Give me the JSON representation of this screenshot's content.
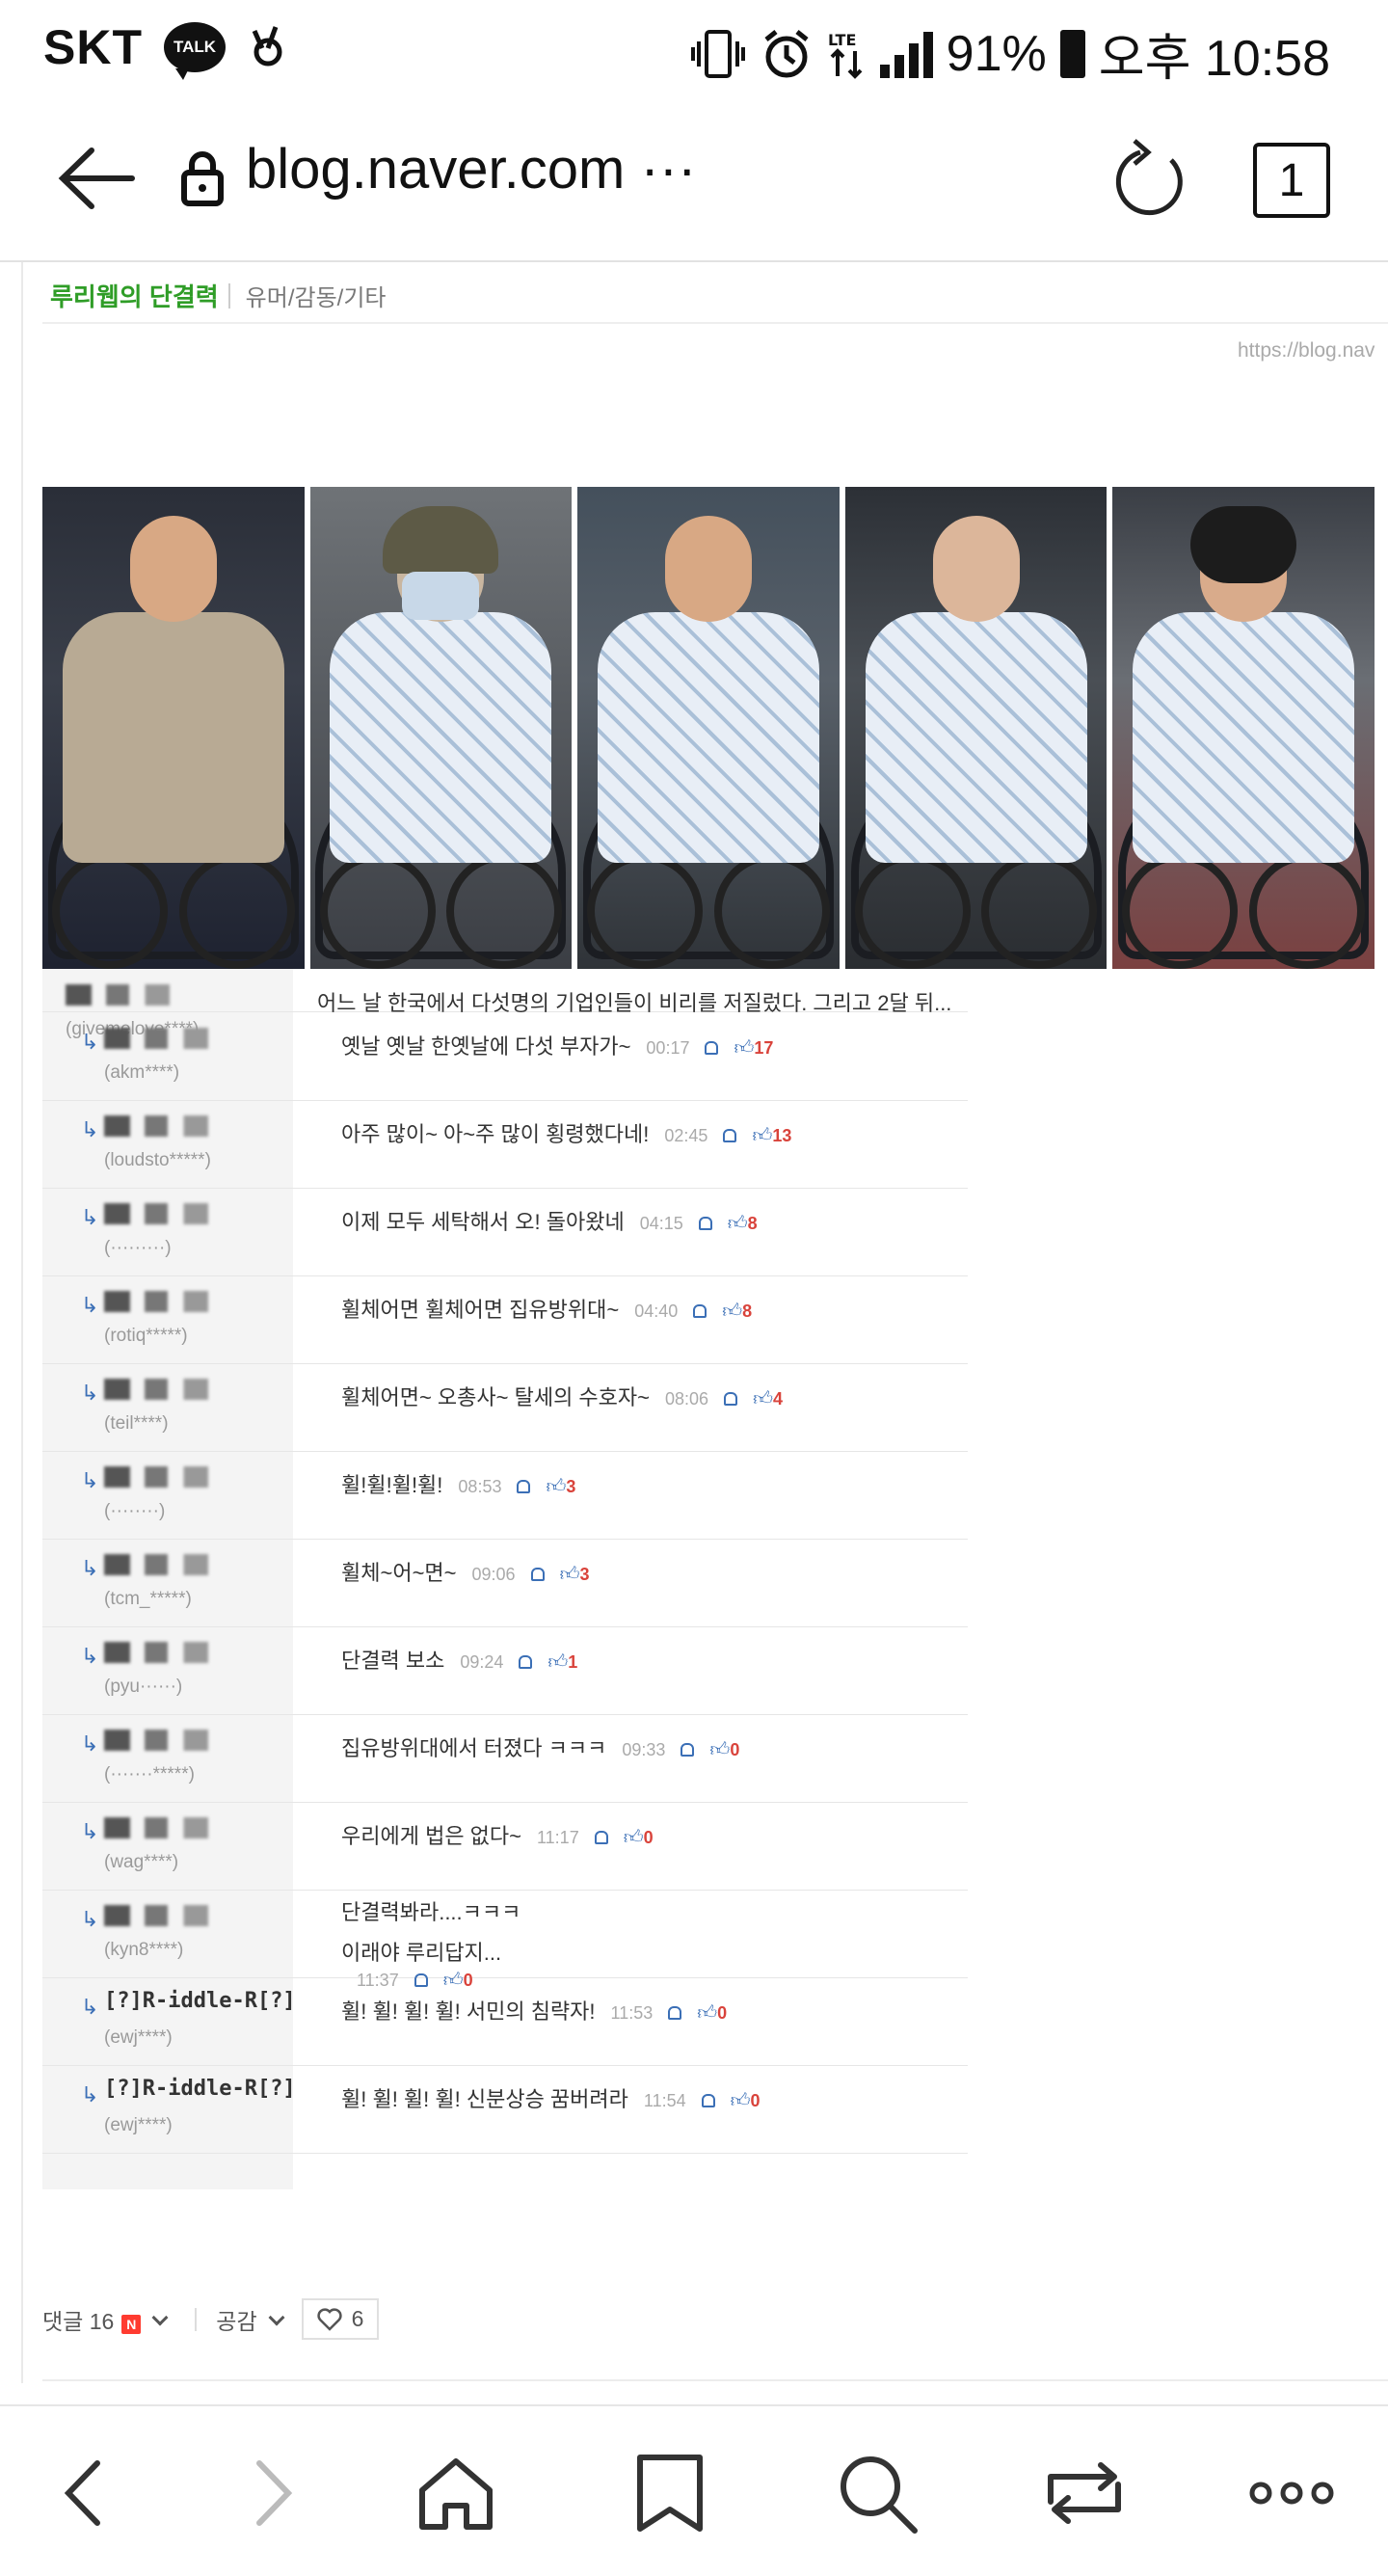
{
  "status_bar": {
    "carrier": "SKT",
    "talk_badge": "TALK",
    "battery_percent": "91%",
    "time": "오후 10:58",
    "battery_level": 0.91
  },
  "address_bar": {
    "url": "blog.naver.com ···",
    "tab_count": "1"
  },
  "category": {
    "blog_name": "루리웹의 단결력",
    "sub_category": "유머/감동/기타"
  },
  "source_url": "https://blog.nav",
  "photo": {
    "people": [
      "person-1",
      "person-2",
      "person-3",
      "person-4",
      "person-5"
    ]
  },
  "comments": [
    {
      "id": "(givemelove****)",
      "text": "어느 날 한국에서 다섯명의 기업인들이 비리를 저질렀다. 그리고 2달 뒤...",
      "first": true
    },
    {
      "id": "(akm****)",
      "text": "옛날 옛날 한옛날에 다섯 부자가~",
      "time": "00:17",
      "likes": "17"
    },
    {
      "id": "(loudsto*****)",
      "text": "아주 많이~ 아~주 많이 횡령했다네!",
      "time": "02:45",
      "likes": "13"
    },
    {
      "id": "(·········)",
      "text": "이제 모두 세탁해서 오! 돌아왔네",
      "time": "04:15",
      "likes": "8"
    },
    {
      "id": "(rotiq*****)",
      "text": "휠체어면 휠체어면 집유방위대~",
      "time": "04:40",
      "likes": "8"
    },
    {
      "id": "(teil****)",
      "text": "휠체어면~ 오총사~ 탈세의 수호자~",
      "time": "08:06",
      "likes": "4"
    },
    {
      "id": "(········)",
      "text": "휠!휠!휠!휠!",
      "time": "08:53",
      "likes": "3"
    },
    {
      "id": "(tcm_*****)",
      "text": "휠체~어~면~",
      "time": "09:06",
      "likes": "3"
    },
    {
      "id": "(pyu······)",
      "text": "단결력 보소",
      "time": "09:24",
      "likes": "1"
    },
    {
      "id": "(·······*****)",
      "text": "집유방위대에서 터졌다 ㅋㅋㅋ",
      "time": "09:33",
      "likes": "0"
    },
    {
      "id": "(wag****)",
      "text": "우리에게 법은 없다~",
      "time": "11:17",
      "likes": "0"
    },
    {
      "id": "(kyn8****)",
      "text": "단결력봐라....ㅋㅋㅋ",
      "text2": "이래야 루리답지...",
      "time": "11:37",
      "likes": "0"
    },
    {
      "id": "(ewj****)",
      "nick": "[?]R-iddle-R[?]",
      "text": "휠! 휠! 휠! 휠! 서민의 침략자!",
      "time": "11:53",
      "likes": "0"
    },
    {
      "id": "(ewj****)",
      "nick": "[?]R-iddle-R[?]",
      "text": "휠! 휠! 휠! 휠! 신분상승 꿈버려라",
      "time": "11:54",
      "likes": "0"
    }
  ],
  "footer": {
    "comments_label": "댓글 16",
    "n_badge": "N",
    "empathy_label": "공감",
    "like_count": "6"
  },
  "bottom_nav": [
    "back",
    "forward",
    "home",
    "bookmarks",
    "search",
    "tabs",
    "more"
  ]
}
